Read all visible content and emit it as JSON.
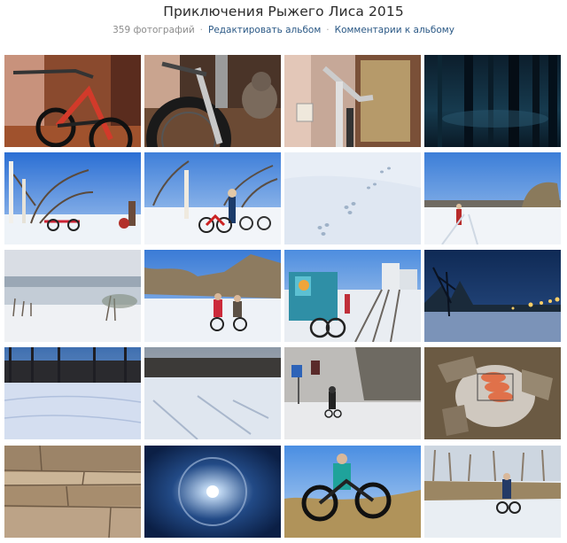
{
  "album": {
    "title": "Приключения Рыжего Лиса 2015",
    "photo_count": "359 фотографий",
    "separator": "·",
    "edit_link": "Редактировать альбом",
    "comments_link": "Комментарии к альбому"
  },
  "photos": [
    {
      "subject": "bike-indoors-hallway"
    },
    {
      "subject": "bike-wheel-with-cat"
    },
    {
      "subject": "bike-fork-near-door"
    },
    {
      "subject": "dark-night-forest"
    },
    {
      "subject": "birch-trees-bikes-snow"
    },
    {
      "subject": "cyclist-with-bikes-snowfield"
    },
    {
      "subject": "animal-tracks-in-snow"
    },
    {
      "subject": "cyclist-on-snowy-trail"
    },
    {
      "subject": "misty-winter-valley"
    },
    {
      "subject": "two-cyclists-in-snow"
    },
    {
      "subject": "bikes-at-railway-kiosk"
    },
    {
      "subject": "night-street-lights"
    },
    {
      "subject": "snowy-field-pine-forest"
    },
    {
      "subject": "tracks-on-snowfield-sunset"
    },
    {
      "subject": "cyclist-riding-snowy-road"
    },
    {
      "subject": "sausages-grilling-on-rocks"
    },
    {
      "subject": "layered-rock-wall"
    },
    {
      "subject": "sun-halo-in-sky"
    },
    {
      "subject": "carrying-bike-through-grass"
    },
    {
      "subject": "cyclist-on-frozen-ice"
    }
  ]
}
